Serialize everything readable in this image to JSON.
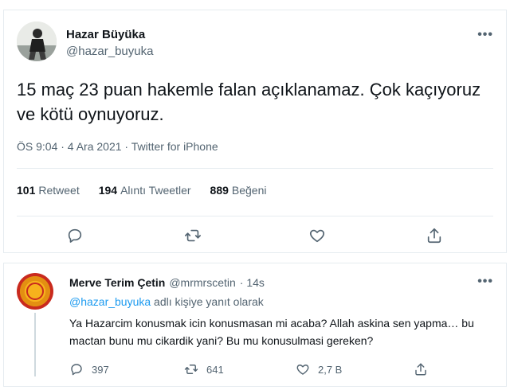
{
  "main_tweet": {
    "author_name": "Hazar Büyüka",
    "author_handle": "@hazar_buyuka",
    "more_label": "•••",
    "text": "15 maç 23 puan hakemle falan açıklanamaz. Çok kaçıyoruz ve kötü oynuyoruz.",
    "meta": "ÖS 9:04 · 4 Ara 2021 · Twitter for iPhone",
    "stats": {
      "retweet_count": "101",
      "retweet_label": "Retweet",
      "quote_count": "194",
      "quote_label": "Alıntı Tweetler",
      "like_count": "889",
      "like_label": "Beğeni"
    },
    "actions": [
      "reply-icon",
      "retweet-icon",
      "like-icon",
      "share-icon"
    ]
  },
  "reply_tweet": {
    "author_name": "Merve Terim Çetin",
    "author_handle": "@mrmrscetin",
    "time": "· 14s",
    "more_label": "•••",
    "replying_handle": "@hazar_buyuka",
    "replying_suffix": " adlı kişiye yanıt olarak",
    "text": "Ya Hazarcim konusmak icin konusmasan mi acaba? Allah askina sen yapma… bu mactan bunu mu cikardik yani? Bu mu konusulmasi gereken?",
    "counts": {
      "replies": "397",
      "retweets": "641",
      "likes": "2,7 B"
    }
  },
  "colors": {
    "text": "#0f1419",
    "secondary": "#536471",
    "link": "#1d9bf0",
    "border": "#e6ecf0"
  }
}
